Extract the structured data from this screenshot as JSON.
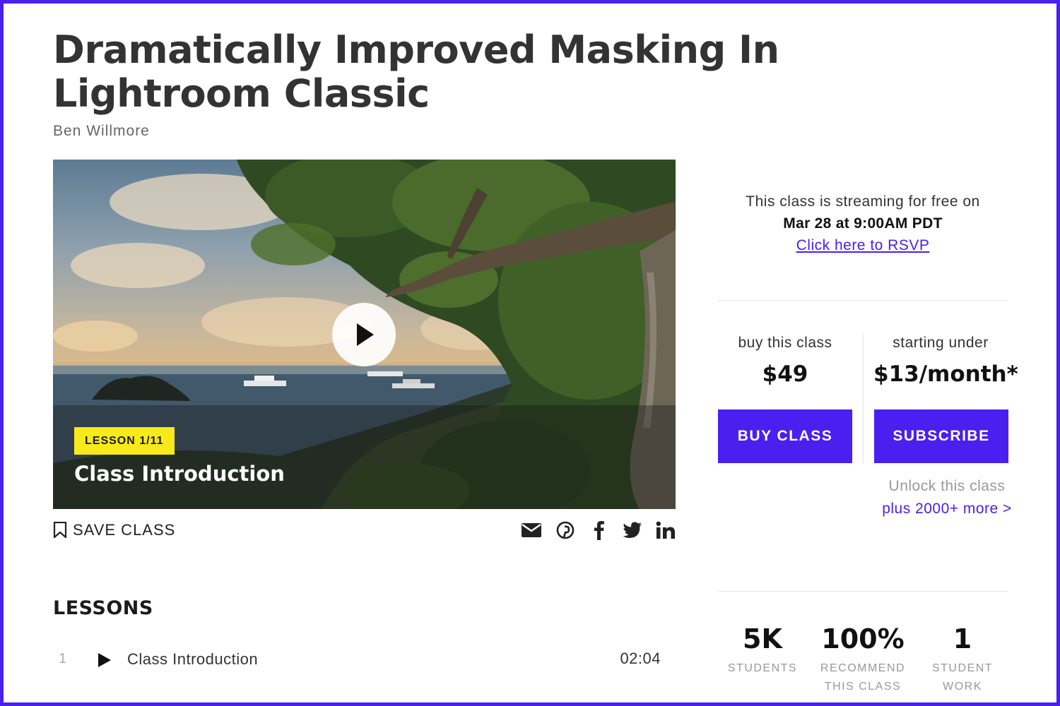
{
  "course": {
    "title": "Dramatically Improved Masking In Lightroom Classic",
    "author": "Ben Willmore"
  },
  "video": {
    "lesson_badge": "LESSON 1/11",
    "lesson_title": "Class Introduction",
    "play_icon": "play-icon"
  },
  "actions": {
    "save_label": "SAVE CLASS",
    "share_icons": [
      "email-icon",
      "pinterest-icon",
      "facebook-icon",
      "twitter-icon",
      "linkedin-icon"
    ]
  },
  "lessons": {
    "heading": "LESSONS",
    "items": [
      {
        "number": "1",
        "title": "Class Introduction",
        "duration": "02:04"
      }
    ]
  },
  "streaming": {
    "text": "This class is streaming for free on",
    "date": "Mar 28 at 9:00AM PDT",
    "rsvp_link": "Click here to RSVP"
  },
  "pricing": {
    "buy_label": "buy this class",
    "buy_price": "$49",
    "buy_button": "BUY CLASS",
    "sub_label": "starting under",
    "sub_price": "$13/month*",
    "sub_button": "SUBSCRIBE",
    "unlock_line1": "Unlock this class",
    "unlock_line2": "plus 2000+ more >"
  },
  "stats": [
    {
      "value": "5K",
      "caption_line1": "STUDENTS",
      "caption_line2": ""
    },
    {
      "value": "100%",
      "caption_line1": "RECOMMEND",
      "caption_line2": "THIS CLASS"
    },
    {
      "value": "1",
      "caption_line1": "STUDENT",
      "caption_line2": "WORK"
    }
  ],
  "colors": {
    "accent": "#4a1ff0",
    "badge": "#f7ea1a",
    "frame": "#4a1ff0"
  }
}
